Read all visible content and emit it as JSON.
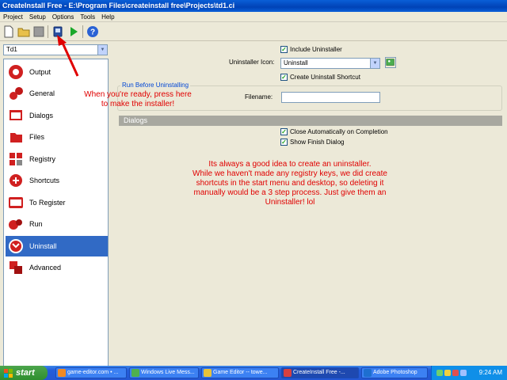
{
  "window": {
    "title": "CreateInstall Free - E:\\Program Files\\createinstall free\\Projects\\td1.ci"
  },
  "menu": [
    "Project",
    "Setup",
    "Options",
    "Tools",
    "Help"
  ],
  "project_combo": {
    "value": "Td1"
  },
  "nav": [
    {
      "label": "Output",
      "icon": "output-icon"
    },
    {
      "label": "General",
      "icon": "general-icon"
    },
    {
      "label": "Dialogs",
      "icon": "dialogs-icon"
    },
    {
      "label": "Files",
      "icon": "files-icon"
    },
    {
      "label": "Registry",
      "icon": "registry-icon"
    },
    {
      "label": "Shortcuts",
      "icon": "shortcuts-icon"
    },
    {
      "label": "To Register",
      "icon": "to-register-icon"
    },
    {
      "label": "Run",
      "icon": "run-icon"
    },
    {
      "label": "Uninstall",
      "icon": "uninstall-icon",
      "active": true
    },
    {
      "label": "Advanced",
      "icon": "advanced-icon"
    }
  ],
  "uninstall": {
    "include_uninstaller": "Include Uninstaller",
    "uninstaller_icon_label": "Uninstaller Icon:",
    "uninstaller_icon_value": "Uninstall",
    "create_shortcut": "Create Uninstall Shortcut",
    "run_before_group": "Run Before Uninstalling",
    "filename_label": "Filename:",
    "filename_value": ""
  },
  "dialogs_section": {
    "title": "Dialogs",
    "close_auto": "Close Automatically on Completion",
    "show_finish": "Show Finish Dialog"
  },
  "annotations": {
    "arrow_note_1": "When you're ready, press here",
    "arrow_note_2": "to make the installer!",
    "main_note": [
      "Its always a good idea to create an uninstaller.",
      "While we haven't made any registry keys, we did create",
      "shortcuts in the start menu and desktop, so deleting it",
      "manually would be a 3 step process. Just give them an",
      "Uninstaller! lol"
    ]
  },
  "taskbar": {
    "start": "start",
    "tasks": [
      {
        "label": "game-editor.com • ...",
        "color": "#f08a24"
      },
      {
        "label": "Windows Live Mess...",
        "color": "#4fb04f"
      },
      {
        "label": "Game Editor -- towe...",
        "color": "#e8c23a"
      },
      {
        "label": "CreateInstall Free -...",
        "color": "#d84040",
        "active": true
      },
      {
        "label": "Adobe Photoshop",
        "color": "#1e6fd0"
      }
    ],
    "time": "9:24 AM"
  },
  "colors": {
    "accent": "#316ac5",
    "annotation": "#e00000",
    "title_bar": "#0a5fd8"
  }
}
